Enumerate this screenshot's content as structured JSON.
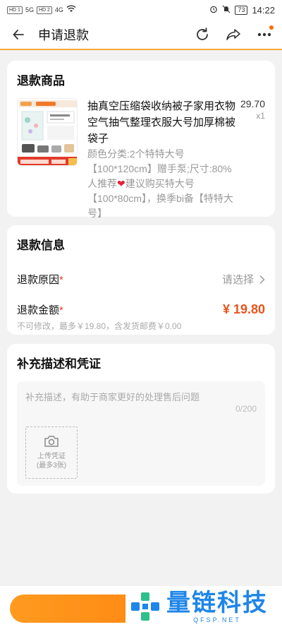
{
  "status_bar": {
    "sim1": "HD 1",
    "sim2": "HD 2",
    "net1": "5G",
    "net2": "4G",
    "battery": "73",
    "time": "14:22"
  },
  "header": {
    "title": "申请退款"
  },
  "goods_card": {
    "title": "退款商品",
    "name": "抽真空压缩袋收纳被子家用衣物空气抽气整理衣服大号加厚棉被袋子",
    "sku_part1": "颜色分类:2个特特大号【100*120cm】赠手泵;尺寸:80%人推荐",
    "sku_heart": "❤",
    "sku_part2": "建议购买特大号【100*80cm】，换季bi备【特特大号】",
    "price": "29.70",
    "qty": "x1"
  },
  "refund_info": {
    "title": "退款信息",
    "reason_label": "退款原因",
    "reason_required": "*",
    "reason_value": "请选择",
    "amount_label": "退款金额",
    "amount_required": "*",
    "amount_value": "¥ 19.80",
    "amount_hint": "不可修改，最多￥19.80，含发货邮费￥0.00"
  },
  "evidence": {
    "title": "补充描述和凭证",
    "placeholder": "补充描述，有助于商家更好的处理售后问题",
    "counter": "0/200",
    "upload_label1": "上传凭证",
    "upload_label2": "(最多3张)"
  },
  "watermark": {
    "brand_cn": "量链科技",
    "brand_en": "QFSP.NET"
  },
  "colors": {
    "accent": "#ff7a0a",
    "price": "#e8551b",
    "brand": "#1e86e8"
  }
}
